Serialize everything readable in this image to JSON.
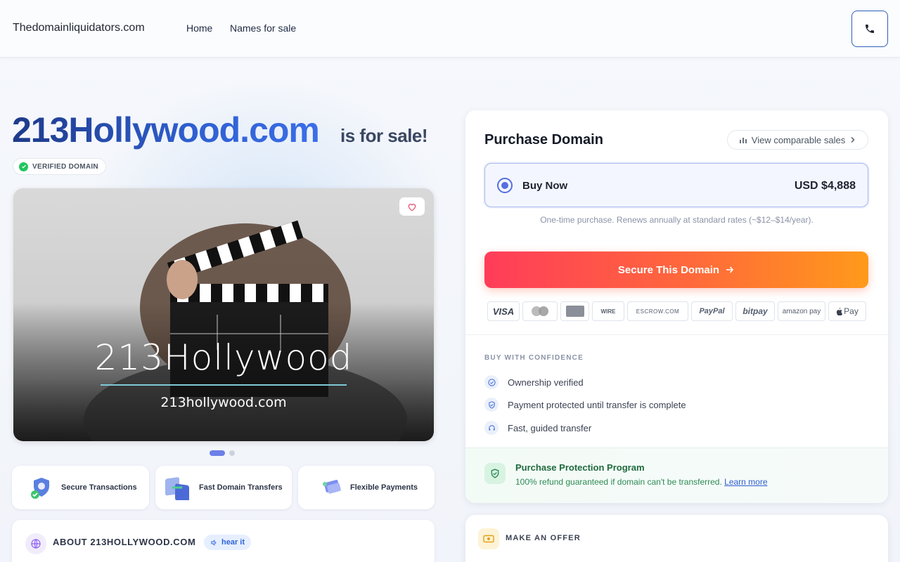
{
  "header": {
    "brand": "Thedomainliquidators.com",
    "nav": [
      {
        "label": "Home"
      },
      {
        "label": "Names for sale"
      }
    ],
    "phone_icon": "phone-icon"
  },
  "hero": {
    "domain": "213Hollywood.com",
    "suffix": "is for sale!",
    "badge": "VERIFIED DOMAIN",
    "image_wordmark": "213Hollywood",
    "image_subtitle": "213hollywood.com",
    "carousel_slides": 2,
    "carousel_active": 1
  },
  "features": [
    {
      "label": "Secure Transactions",
      "icon": "shield-check-icon"
    },
    {
      "label": "Fast Domain Transfers",
      "icon": "transfer-icon"
    },
    {
      "label": "Flexible Payments",
      "icon": "payment-card-icon"
    }
  ],
  "about": {
    "title": "ABOUT 213HOLLYWOOD.COM",
    "hear": "hear it"
  },
  "purchase": {
    "title": "Purchase Domain",
    "comparable": "View comparable sales",
    "option_label": "Buy Now",
    "price": "USD $4,888",
    "renew_note": "One-time purchase. Renews annually at standard rates (~$12–$14/year).",
    "cta": "Secure This Domain",
    "payment_methods": [
      "VISA",
      "MasterCard",
      "AMEX",
      "WIRE",
      "ESCROW.COM",
      "PayPal",
      "bitpay",
      "amazon pay",
      "Pay"
    ],
    "confidence_title": "BUY WITH CONFIDENCE",
    "confidence": [
      "Ownership verified",
      "Payment protected until transfer is complete",
      "Fast, guided transfer"
    ],
    "protection_title": "Purchase Protection Program",
    "protection_text": "100% refund guaranteed if domain can't be transferred.",
    "learn_more": "Learn more"
  },
  "offer": {
    "title": "MAKE AN OFFER"
  },
  "colors": {
    "brand_blue": "#2f5fd0",
    "cta_start": "#ff3c5a",
    "cta_end": "#ff9a1a",
    "protect_green": "#1f6a3e"
  }
}
